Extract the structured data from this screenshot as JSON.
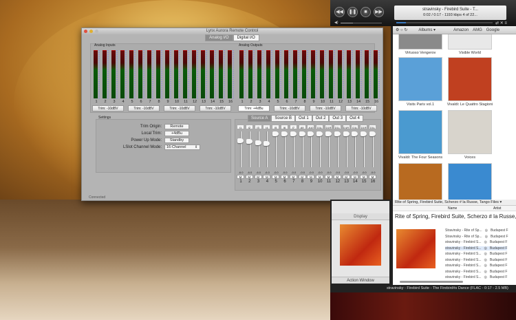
{
  "lynx": {
    "title": "Lynx Aurora Remote Control",
    "tabs": [
      "Analog I/O",
      "Digital I/O"
    ],
    "analog_inputs": {
      "label": "Analog Inputs",
      "trims": [
        "Trim: -10dBV",
        "Trim: -10dBV",
        "Trim: -10dBV",
        "Trim: -10dBV"
      ]
    },
    "analog_outputs": {
      "label": "Analog Outputs",
      "trims": [
        "Trim: +4dBu",
        "Trim: -10dBV",
        "Trim: -10dBV",
        "Trim: -10dBV"
      ]
    },
    "settings": {
      "label": "Settings",
      "rows": [
        {
          "label": "Trim Origin:",
          "value": "Remote"
        },
        {
          "label": "Local Trim:",
          "value": "+4dBu"
        },
        {
          "label": "Power Up Mode:",
          "value": "Standby"
        },
        {
          "label": "LSlot Channel Mode:",
          "value": "16-Channel"
        }
      ]
    },
    "source_tabs": [
      "Source A",
      "Source B",
      "Out 1",
      "Out 2",
      "Out 3",
      "Out 4"
    ],
    "fader_sources": [
      "I1",
      "I2",
      "I3",
      "I4",
      "I5",
      "I6",
      "I7",
      "A9",
      "A10",
      "D1L",
      "D1R",
      "D1L",
      "D1R",
      "D1L",
      "D1R",
      "D1L"
    ],
    "fader_db": [
      "-6.0",
      "-6.0",
      "-6.0",
      "-6.0",
      "-0.0",
      "-0.0",
      "-0.0",
      "-0.0",
      "-0.0",
      "-0.0",
      "-0.0",
      "-0.0",
      "-0.0",
      "-0.0",
      "-0.0",
      "-0.0"
    ],
    "mute_label": "M",
    "status": "Connected"
  },
  "channels": [
    "1",
    "2",
    "3",
    "4",
    "5",
    "6",
    "7",
    "8",
    "9",
    "10",
    "11",
    "12",
    "13",
    "14",
    "15",
    "16"
  ],
  "player": {
    "line1": "stravinsky - Firebird Suite - T...",
    "line2": "0:02 / 0:17 - 1193 kbps   4 of 22...",
    "progress": 0.1,
    "volume": 0.3
  },
  "browser": {
    "menu": "Albums ▾",
    "links": [
      "Amazon",
      "AMG",
      "Google"
    ],
    "albums": [
      "Virtuoso Vengerov",
      "Visible World",
      "Visits Paris vol.1",
      "Vivaldi: Le Quattro Stagioni",
      "Vivaldi: The Four Seasons",
      "Voices",
      "",
      ""
    ],
    "colors": [
      "#8a8a8a",
      "#e8e8e8",
      "#5aa0d8",
      "#c04020",
      "#4a9ad0",
      "#d8d4cc",
      "#b86a20",
      "#3a8ad0"
    ]
  },
  "sidepanel": {
    "header": "Display",
    "footer": "Action Window"
  },
  "tracklist": {
    "header": "Rite of Spring, Firebird Suite, Scherzo # la Russe, Tango Files ▾",
    "col_name": "Name",
    "col_artist": "Artist",
    "album_title": "Rite of Spring, Firebird Suite, Scherzo # la Russe,",
    "rows": [
      {
        "name": "Stravinsky - Rite of Sp...",
        "artist": "Budapest F"
      },
      {
        "name": "Stravinsky - Rite of Sp...",
        "artist": "Budapest F"
      },
      {
        "name": "stravinsky - Firebird S...",
        "artist": "Budapest F"
      },
      {
        "name": "stravinsky - Firebird S...",
        "artist": "Budapest F"
      },
      {
        "name": "stravinsky - Firebird S...",
        "artist": "Budapest F"
      },
      {
        "name": "stravinsky - Firebird S...",
        "artist": "Budapest F"
      },
      {
        "name": "stravinsky - Firebird S...",
        "artist": "Budapest F"
      },
      {
        "name": "stravinsky - Firebird S...",
        "artist": "Budapest F"
      },
      {
        "name": "stravinsky - Firebird S...",
        "artist": "Budapest F"
      }
    ]
  },
  "statusbar": "stravinsky - Firebird Suite - The Firebird#s Dance (FLAC - 0:17 - 2.5 MB)"
}
